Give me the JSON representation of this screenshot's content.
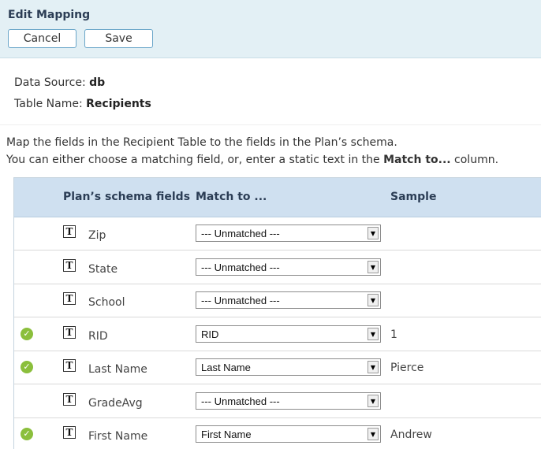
{
  "header": {
    "title": "Edit Mapping",
    "cancel_label": "Cancel",
    "save_label": "Save"
  },
  "info": {
    "source_label": "Data Source:",
    "source_value": "db",
    "table_label": "Table Name:",
    "table_value": "Recipients"
  },
  "description": {
    "line1": "Map the fields in the Recipient Table to the fields in the Plan’s schema.",
    "line2_prefix": "You can either choose a matching field, or, enter a static text in the",
    "line2_bold": "Match to...",
    "line2_suffix": "column."
  },
  "grid": {
    "columns": {
      "fields": "Plan’s schema fields",
      "match": "Match to ...",
      "sample": "Sample"
    },
    "rows": [
      {
        "field": "Zip",
        "match": "--- Unmatched ---",
        "sample": "",
        "matched": false
      },
      {
        "field": "State",
        "match": "--- Unmatched ---",
        "sample": "",
        "matched": false
      },
      {
        "field": "School",
        "match": "--- Unmatched ---",
        "sample": "",
        "matched": false
      },
      {
        "field": "RID",
        "match": "RID",
        "sample": "1",
        "matched": true
      },
      {
        "field": "Last Name",
        "match": "Last Name",
        "sample": "Pierce",
        "matched": true
      },
      {
        "field": "GradeAvg",
        "match": "--- Unmatched ---",
        "sample": "",
        "matched": false
      },
      {
        "field": "First Name",
        "match": "First Name",
        "sample": "Andrew",
        "matched": true
      }
    ],
    "type_icon_glyph": "T",
    "check_icon_glyph": "✓",
    "dropdown_arrow_glyph": "▼"
  },
  "colors": {
    "header_bg": "#e3f0f5",
    "grid_header_bg": "#cfe0f0",
    "check_green": "#8bbf3c",
    "button_border": "#6aa6c9"
  }
}
